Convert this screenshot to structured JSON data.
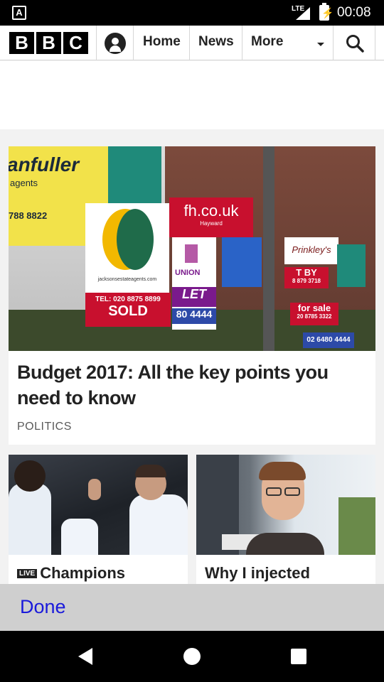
{
  "status_bar": {
    "network": "LTE",
    "time": "00:08"
  },
  "header": {
    "logo_letters": [
      "B",
      "B",
      "C"
    ],
    "nav": {
      "home": "Home",
      "news": "News",
      "more": "More"
    }
  },
  "lead_story": {
    "headline": "Budget 2017: All the key points you need to know",
    "tag": "POLITICS",
    "image_signs": {
      "anfuller": "anfuller",
      "agents": "agents",
      "phone_left": "788 8822",
      "fh": "fh.co.uk",
      "hayward": "Hayward",
      "union": "UNION",
      "let": "LET",
      "let_phone": "80 4444",
      "tel": "TEL: 020 8875 8899",
      "sold": "SOLD",
      "jackson": "jacksonsestateagents.com",
      "prinkleys": "Prinkley's",
      "t_by": "T BY",
      "t_by_phone": "8 879 3718",
      "for_sale": "for sale",
      "for_sale_phone": "20 8785 3322",
      "right_phone": "02 6480 4444"
    }
  },
  "stories": [
    {
      "badge": "LIVE",
      "title": "Champions"
    },
    {
      "title": "Why I injected"
    }
  ],
  "done_bar": {
    "label": "Done"
  },
  "colors": {
    "accent_link": "#1a1adb",
    "sold_red": "#c8102e",
    "let_purple": "#7a1a8c",
    "sign_yellow": "#f2e24a"
  }
}
